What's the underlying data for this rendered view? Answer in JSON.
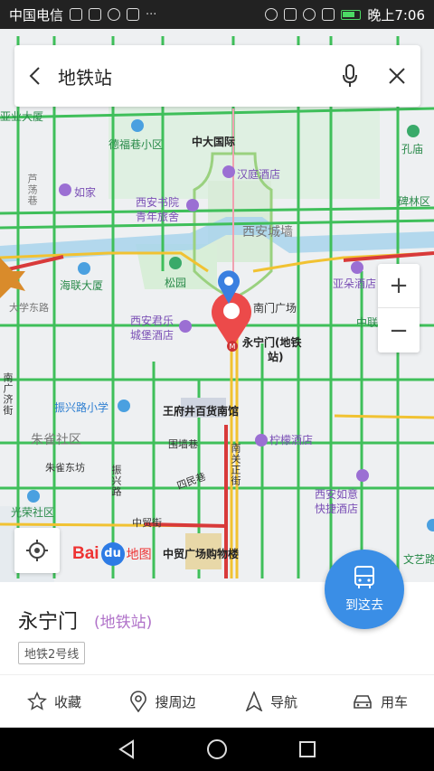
{
  "status_bar": {
    "carrier": "中国电信",
    "time": "晚上7:06",
    "icons": [
      "app-icon",
      "alarm-icon",
      "nfc-icon",
      "wifi-icon",
      "signal-icon",
      "battery-icon"
    ]
  },
  "search": {
    "query": "地铁站"
  },
  "map": {
    "labels": {
      "dafu": "中大国际",
      "dexiang": "德福巷小区",
      "hanting": "汉庭酒店",
      "kongmiao": "孔庙",
      "beilin": "碑林区",
      "rujia": "如家",
      "shuyuan1": "西安书院",
      "shuyuan2": "青年旅舍",
      "xianchengqiang": "西安城墙",
      "lumei": "芦荡巷",
      "songyuan": "松园",
      "haiyan": "海联大厦",
      "yaduo": "亚朵酒店",
      "dadong": "大学东路",
      "junle1": "西安君乐",
      "junle2": "城堡酒店",
      "nanmen": "南门广场",
      "yongning_label1": "永宁门(地铁",
      "yongning_label2": "站)",
      "zhenxing": "振兴路小学",
      "wangfujing": "王府井百货南馆",
      "zhuque": "朱雀社区",
      "weiqiang": "围墙巷",
      "ningmeng": "柠檬酒店",
      "zhuquedongfang": "朱雀东坊",
      "zhenxinglu": "振兴路",
      "sidaoxiang": "四民巷",
      "nanguan": "南关正街",
      "ruyi1": "西安如意",
      "ruyi2": "快捷酒店",
      "guangrong": "光荣社区",
      "zhongmaojie": "中贸街",
      "zhongmao": "中贸广场购物楼",
      "wenyi": "文艺路",
      "zhonglian": "中联",
      "yeda": "亚业大厦",
      "street_left": "南广济街"
    }
  },
  "zoom": {
    "in": "+",
    "out": "−"
  },
  "logo": {
    "bai": "Bai",
    "du": "du",
    "ditu": "地图"
  },
  "goto_button": {
    "label": "到这去"
  },
  "place": {
    "name": "永宁门",
    "type": "(地铁站)",
    "line": "地铁2号线"
  },
  "actions": {
    "favorite": "收藏",
    "nearby": "搜周边",
    "navigate": "导航",
    "taxi": "用车"
  }
}
